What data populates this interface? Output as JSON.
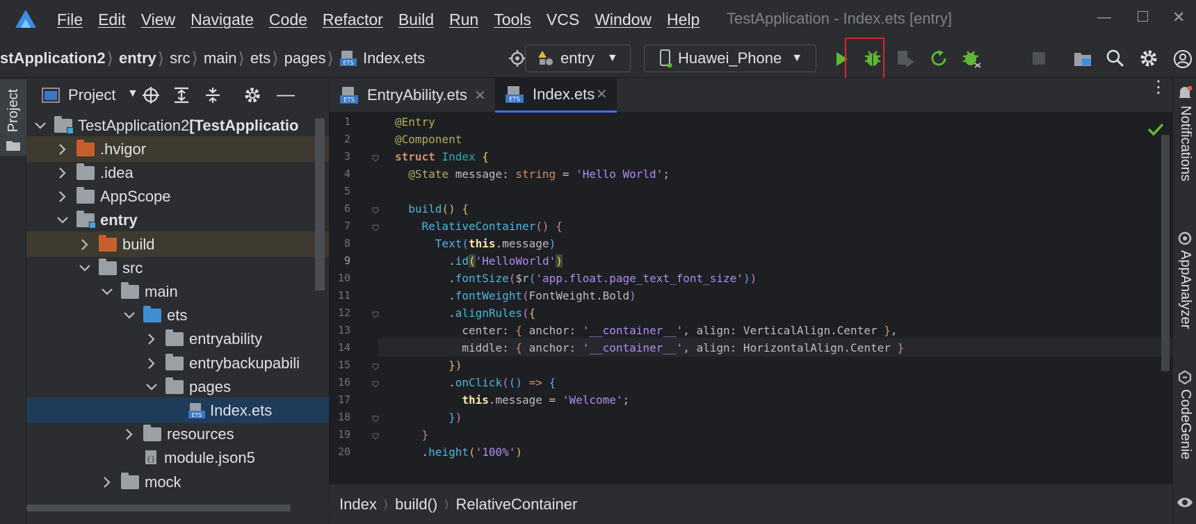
{
  "menu": [
    "File",
    "Edit",
    "View",
    "Navigate",
    "Code",
    "Refactor",
    "Build",
    "Run",
    "Tools",
    "VCS",
    "Window",
    "Help"
  ],
  "window_title": "TestApplication - Index.ets [entry]",
  "breadcrumbs": [
    "stApplication2",
    "entry",
    "src",
    "main",
    "ets",
    "pages",
    "Index.ets"
  ],
  "module_combo": "entry",
  "device_combo": "Huawei_Phone",
  "project_panel_title": "Project",
  "left_strip_label": "Project",
  "tree": [
    {
      "label": "TestApplication2",
      "suffix": "[TestApplicatio",
      "level": 0,
      "arrow": "open",
      "icon": "module"
    },
    {
      "label": ".hvigor",
      "level": 1,
      "arrow": "closed",
      "icon": "folder-orange"
    },
    {
      "label": ".idea",
      "level": 1,
      "arrow": "closed",
      "icon": "folder"
    },
    {
      "label": "AppScope",
      "level": 1,
      "arrow": "closed",
      "icon": "folder"
    },
    {
      "label": "entry",
      "level": 1,
      "arrow": "open",
      "icon": "module"
    },
    {
      "label": "build",
      "level": 2,
      "arrow": "closed",
      "icon": "folder-orange"
    },
    {
      "label": "src",
      "level": 2,
      "arrow": "open",
      "icon": "folder"
    },
    {
      "label": "main",
      "level": 3,
      "arrow": "open",
      "icon": "folder"
    },
    {
      "label": "ets",
      "level": 4,
      "arrow": "open",
      "icon": "folder-blue"
    },
    {
      "label": "entryability",
      "level": 5,
      "arrow": "closed",
      "icon": "folder"
    },
    {
      "label": "entrybackupabili",
      "level": 5,
      "arrow": "closed",
      "icon": "folder"
    },
    {
      "label": "pages",
      "level": 5,
      "arrow": "open",
      "icon": "folder"
    },
    {
      "label": "Index.ets",
      "level": 6,
      "arrow": "none",
      "icon": "ets"
    },
    {
      "label": "resources",
      "level": 4,
      "arrow": "closed",
      "icon": "folder"
    },
    {
      "label": "module.json5",
      "level": 4,
      "arrow": "none",
      "icon": "json"
    },
    {
      "label": "mock",
      "level": 3,
      "arrow": "closed",
      "icon": "folder"
    }
  ],
  "tabs": [
    {
      "label": "EntryAbility.ets",
      "active": false
    },
    {
      "label": "Index.ets",
      "active": true
    }
  ],
  "line_numbers": [
    "1",
    "2",
    "3",
    "4",
    "5",
    "6",
    "7",
    "8",
    "9",
    "10",
    "11",
    "12",
    "13",
    "14",
    "15",
    "16",
    "17",
    "18",
    "19",
    "20"
  ],
  "status_crumbs": [
    "Index",
    "build()",
    "RelativeContainer"
  ],
  "right_strip": [
    "Notifications",
    "AppAnalyzer",
    "CodeGenie"
  ],
  "colors": {
    "run_green": "#5fb832",
    "highlight_box": "#e0252a",
    "accent": "#3574f0"
  }
}
